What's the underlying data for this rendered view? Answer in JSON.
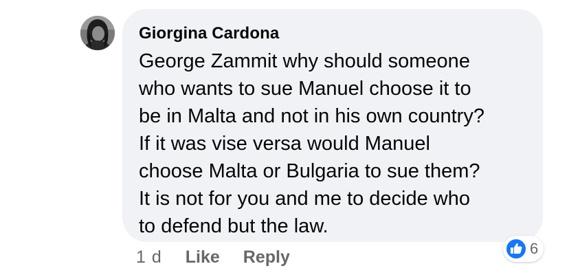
{
  "comment": {
    "author": "Giorgina Cardona",
    "text": "George Zammit why should someone\nwho wants to sue Manuel choose it to\nbe in Malta and not in his own country?\nIf it was vise versa would Manuel\nchoose Malta or Bulgaria to sue them?\nIt is not for you and me to decide who\nto defend but the law.",
    "timestamp": "1 d",
    "like_label": "Like",
    "reply_label": "Reply",
    "reaction_count": "6",
    "reaction_icon": "like-reaction-icon"
  },
  "colors": {
    "bubble_bg": "#f0f2f5",
    "text": "#050505",
    "secondary_text": "#65676b",
    "like_blue": "#1877f2"
  }
}
